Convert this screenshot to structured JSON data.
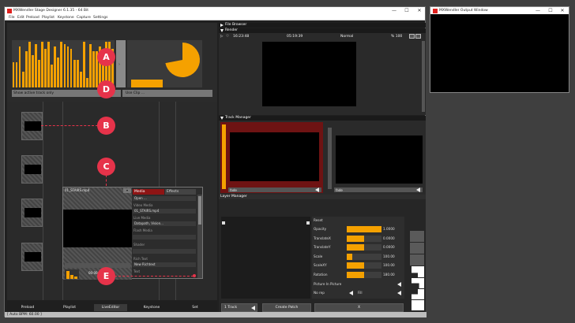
{
  "main_window": {
    "title": "MXWendler Stage Designer 6.1.35 - 64 Bit",
    "menu": [
      "File",
      "Edit",
      "Preload",
      "Playlist",
      "Keystone",
      "Capture",
      "Settings"
    ],
    "show_active_track_label": "Show active track only",
    "use_clip_label": "Use Clip ...",
    "bottom_tabs": [
      "Preload",
      "Playlist",
      "LiveEditor",
      "Keystone",
      "Set"
    ],
    "status": "[ Auto BPM: 60.00 ]"
  },
  "callouts": [
    "A",
    "B",
    "C",
    "D",
    "E"
  ],
  "live_editor": {
    "clip_title": "01_STAIRS.mp4",
    "media_tab": "Media",
    "effects_tab": "Effects",
    "open_button": "Open ...",
    "video_media_label": "Video Media",
    "video_media_value": "01_STAIRS.mp4",
    "live_media_label": "Live Media",
    "live_media_value": "Datapath, Vision...",
    "flash_media_label": "Flash Media",
    "shader_label": "Shader",
    "rich_text_label": "Rich Text",
    "rich_text_value": "New Richtext",
    "text_label": "Text",
    "timecode": "00:00"
  },
  "file_browser": {
    "title": "File Browser"
  },
  "render": {
    "title": "Render",
    "time1": "16:23:48",
    "time2": "05:19:39",
    "mode": "Normal",
    "zoom": "% 100"
  },
  "track_manager": {
    "title": "Track Manager",
    "tracks": [
      {
        "fade_label": "fade"
      },
      {
        "fade_label": "fade"
      }
    ]
  },
  "layer_manager": {
    "title": "Layer Manager",
    "reset_label": "Reset",
    "params": [
      {
        "name": "Opacity",
        "value": "1.0000",
        "fill": 1.0
      },
      {
        "name": "TranslateX",
        "value": "0.0000",
        "fill": 0.5
      },
      {
        "name": "TranslateY",
        "value": "0.0000",
        "fill": 0.5
      },
      {
        "name": "Scale",
        "value": "100.00",
        "fill": 0.15
      },
      {
        "name": "ScaleXY",
        "value": "100.00",
        "fill": 0.5
      },
      {
        "name": "Rotation",
        "value": "180.00",
        "fill": 0.5
      }
    ],
    "pip_label": "Picture In Picture",
    "no_rep_label": "No rep",
    "fill_label": "Fill",
    "track_button": "1 Track",
    "create_patch_button": "Create Patch",
    "x_button": "X"
  },
  "output_window": {
    "title": "MXWendler Output Window"
  },
  "colors": {
    "accent": "#f5a100",
    "callout": "#e6334a",
    "brand": "#e0211e",
    "track_red": "#6e1313"
  },
  "meter_levels": [
    0.55,
    0.55,
    0.9,
    0.35,
    0.8,
    1.0,
    0.7,
    0.95,
    0.6,
    1.0,
    0.85,
    1.0,
    0.5,
    0.9,
    0.65,
    1.0,
    0.95,
    0.9,
    0.85,
    0.6,
    0.6,
    0.35,
    1.0,
    0.2,
    0.95,
    0.8,
    0.8,
    0.9,
    0.75,
    1.0,
    1.0,
    0.85
  ],
  "pie_fraction": 0.72
}
